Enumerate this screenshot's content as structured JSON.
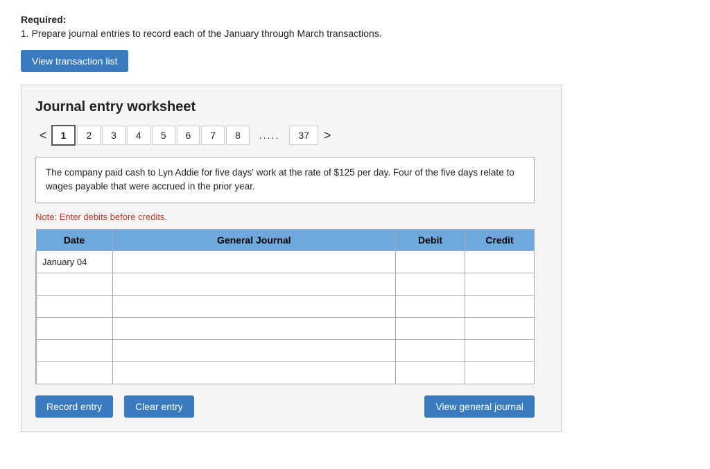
{
  "required": {
    "label": "Required:",
    "instruction": "1. Prepare journal entries to record each of the January through March transactions."
  },
  "buttons": {
    "view_transaction": "View transaction list",
    "record_entry": "Record entry",
    "clear_entry": "Clear entry",
    "view_general_journal": "View general journal"
  },
  "worksheet": {
    "title": "Journal entry worksheet",
    "tabs": [
      {
        "label": "1",
        "active": true
      },
      {
        "label": "2"
      },
      {
        "label": "3"
      },
      {
        "label": "4"
      },
      {
        "label": "5"
      },
      {
        "label": "6"
      },
      {
        "label": "7"
      },
      {
        "label": "8"
      },
      {
        "label": "...",
        "dots": true
      },
      {
        "label": "37"
      }
    ],
    "description": "The company paid cash to Lyn Addie for five days' work at the rate of $125 per day. Four of the five days relate to wages payable that were accrued in the prior year.",
    "note": "Note: Enter debits before credits.",
    "table": {
      "headers": [
        "Date",
        "General Journal",
        "Debit",
        "Credit"
      ],
      "rows": [
        {
          "date": "January 04",
          "journal": "",
          "debit": "",
          "credit": ""
        },
        {
          "date": "",
          "journal": "",
          "debit": "",
          "credit": ""
        },
        {
          "date": "",
          "journal": "",
          "debit": "",
          "credit": ""
        },
        {
          "date": "",
          "journal": "",
          "debit": "",
          "credit": ""
        },
        {
          "date": "",
          "journal": "",
          "debit": "",
          "credit": ""
        },
        {
          "date": "",
          "journal": "",
          "debit": "",
          "credit": ""
        }
      ]
    }
  }
}
